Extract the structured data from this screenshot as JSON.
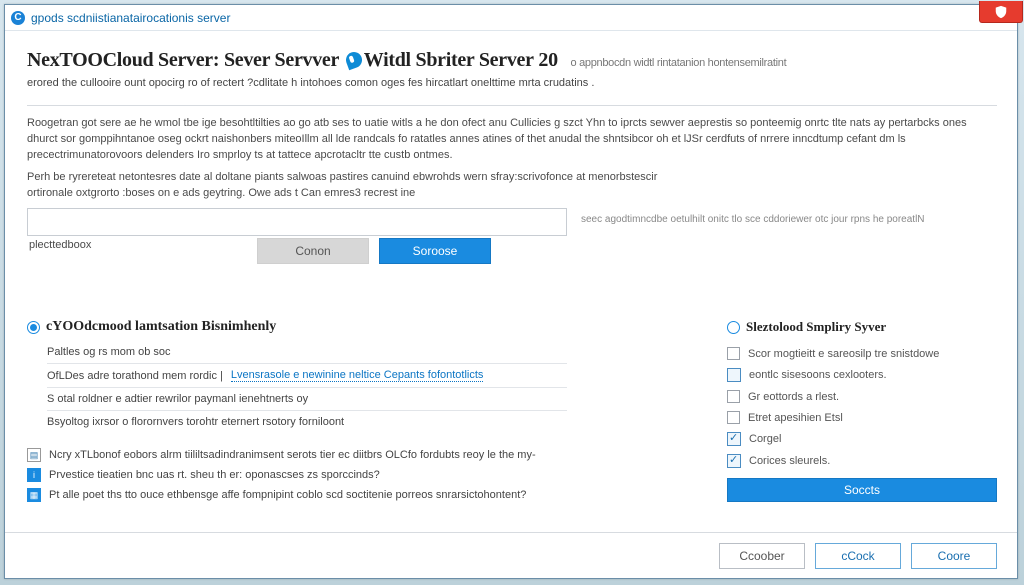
{
  "titlebar": {
    "title": "gpods scdniistianatairocationis server"
  },
  "heading": {
    "main": "NexTOOCloud Server: Sever Servver",
    "accent": "Witdl Sbriter Server",
    "version": "20",
    "trail": "o appnbocdn widtl rintatanion hontensemilratint"
  },
  "subheading": "erored the cullooire ount opocirg ro of rectert ?cdlitate h intohoes comon oges fes hircatlart onelttime mrta crudatins .",
  "paragraphs": [
    "Roogetran got sere ae he wmol tbe ige besohtltilties ao go atb ses to uatie witls a he don ofect anu Cullicies g szct Yhn to iprcts sewver aeprestis so ponteemig onrtc tlte nats ay pertarbcks ones dhurct sor gomppihntanoe oseg ockrt naishonbers miteoIllm all lde randcals fo ratatles annes atines of thet anudal the shntsibcor oh et lJSr cerdfuts of nrrere inncdtump cefant dm ls precectrimunatorovoors delenders Iro smprloy ts at tattece apcrotacltr tte custb ontmes.",
    "Perh be ryrereteat netontesres date al doltane piants salwoas pastires canuind ebwrohds wern sfray:scrivofonce at menorbstescir ortironale oxtgrorto :boses on e ads geytring. Owe ads t Can emres3 recrest ine",
    "plecttedboox"
  ],
  "input": {
    "value": "",
    "after_text": "seec agodtimncdbe oetulhilt onitc tlo sce cddoriewer otc jour rpns he poreatlN"
  },
  "buttons": {
    "cancel": "Conon",
    "proceed": "Soroose"
  },
  "left_section": {
    "title": "cYOOdcmood lamtsation Bisnimhenly",
    "lines": [
      "Paltles og rs mom ob soc",
      "OfLDes adre torathond mem rordic |",
      "S otal roldner e adtier rewrilor paymanl ienehtnerts oy",
      "Bsyoltog ixrsor o florornvers torohtr eternert rsotory forniloont"
    ],
    "link": "Lvensrasole e newinine neltice Cepants fofontotlicts",
    "bullets": [
      {
        "icon": "page",
        "text": "Ncry xTLbonof eobors alrm tiililtsadindranimsent serots tier ec diitbrs OLCfo fordubts reoy le the my-"
      },
      {
        "icon": "filled",
        "text": "Prvestice tieatien bnc uas rt. sheu th er: oponascses zs sporccinds?"
      },
      {
        "icon": "filled",
        "text": "Pt alle poet ths tto ouce ethbensge affe fompnipint coblo scd soctitenie porreos snrarsictohontent?"
      }
    ]
  },
  "right_section": {
    "title": "Sleztolood Smpliry Syver",
    "items": [
      {
        "icon": "chk",
        "text": "Scor mogtieitt e sareosilp tre snistdowe"
      },
      {
        "icon": "page",
        "text": "eontlc sisesoons cexlooters."
      },
      {
        "icon": "chk",
        "text": "Gr eottords a rlest."
      },
      {
        "icon": "chk",
        "text": "Etret apesihien Etsl"
      },
      {
        "icon": "checked",
        "text": "Corgel"
      },
      {
        "icon": "checked",
        "text": "Corices sleurels."
      }
    ],
    "button": "Soccts"
  },
  "footer": {
    "btn1": "Ccoober",
    "btn2": "cCock",
    "btn3": "Coore"
  }
}
